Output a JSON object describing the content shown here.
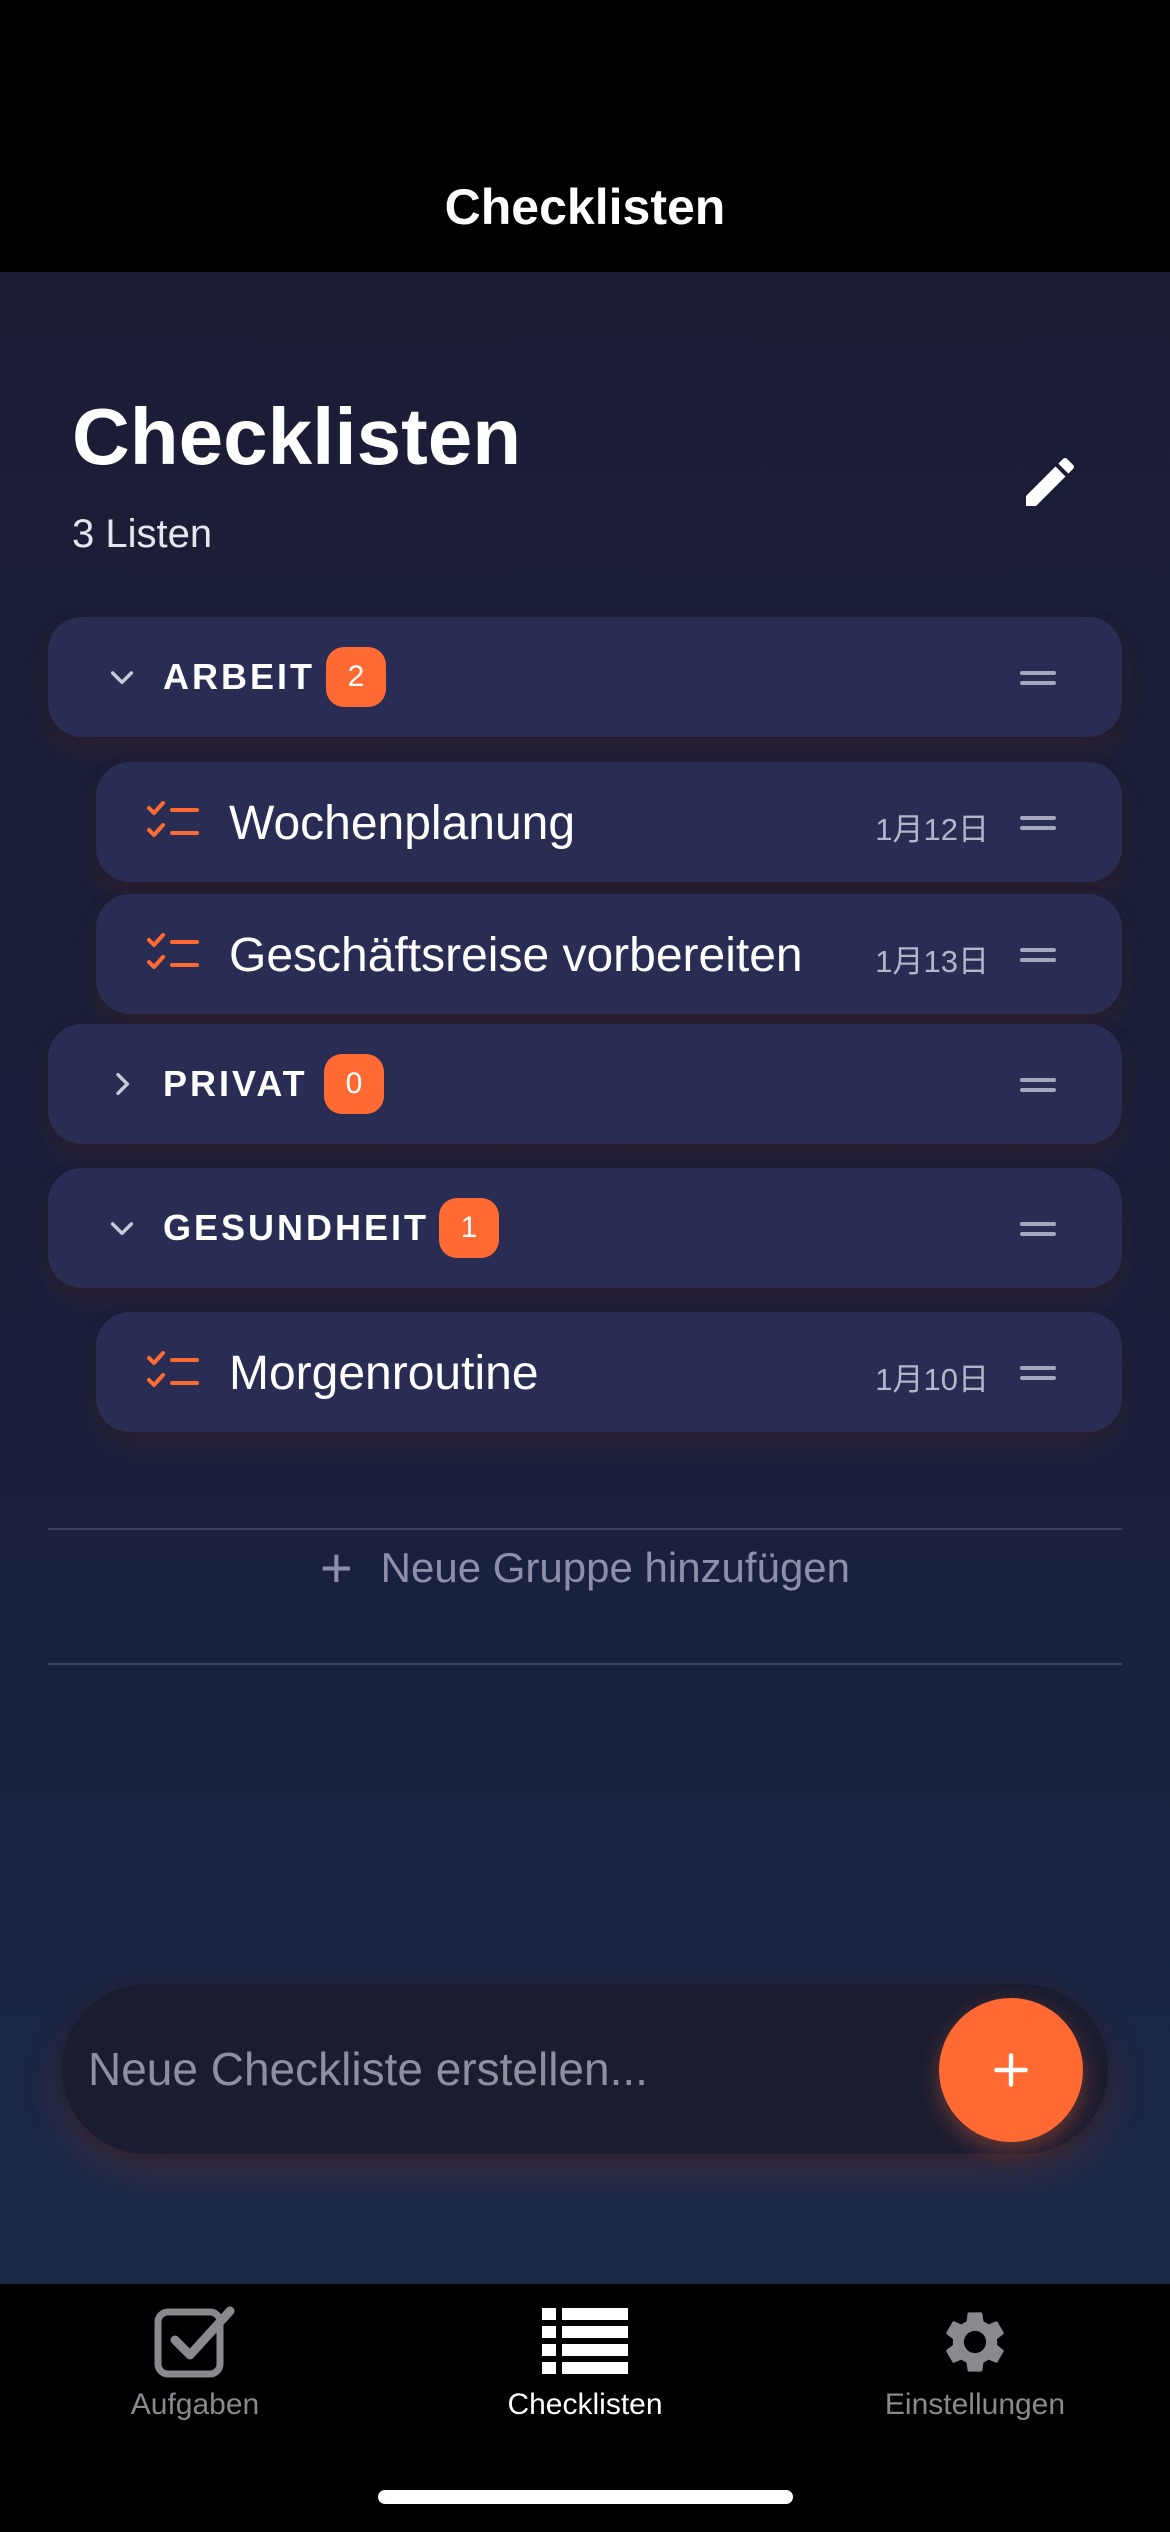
{
  "navbar": {
    "title": "Checklisten"
  },
  "header": {
    "title": "Checklisten",
    "subtitle": "3 Listen",
    "edit_icon": "pencil-icon"
  },
  "groups": [
    {
      "name": "ARBEIT",
      "count": "2",
      "expanded": true,
      "items": [
        {
          "title": "Wochenplanung",
          "date": "1月12日"
        },
        {
          "title": "Geschäftsreise vorbereiten",
          "date": "1月13日"
        }
      ]
    },
    {
      "name": "PRIVAT",
      "count": "0",
      "expanded": false,
      "items": []
    },
    {
      "name": "GESUNDHEIT",
      "count": "1",
      "expanded": true,
      "items": [
        {
          "title": "Morgenroutine",
          "date": "1月10日"
        }
      ]
    }
  ],
  "add_group": {
    "label": "Neue Gruppe hinzufügen"
  },
  "new_checklist": {
    "placeholder": "Neue Checkliste erstellen...",
    "button_icon": "plus-icon"
  },
  "tabbar": {
    "tabs": [
      {
        "label": "Aufgaben",
        "icon": "checkbox-icon",
        "active": false
      },
      {
        "label": "Checklisten",
        "icon": "list-icon",
        "active": true
      },
      {
        "label": "Einstellungen",
        "icon": "gear-icon",
        "active": false
      }
    ]
  },
  "colors": {
    "accent": "#ff6a33",
    "row_background": "#2a2d53",
    "background": "#1b1d35"
  }
}
